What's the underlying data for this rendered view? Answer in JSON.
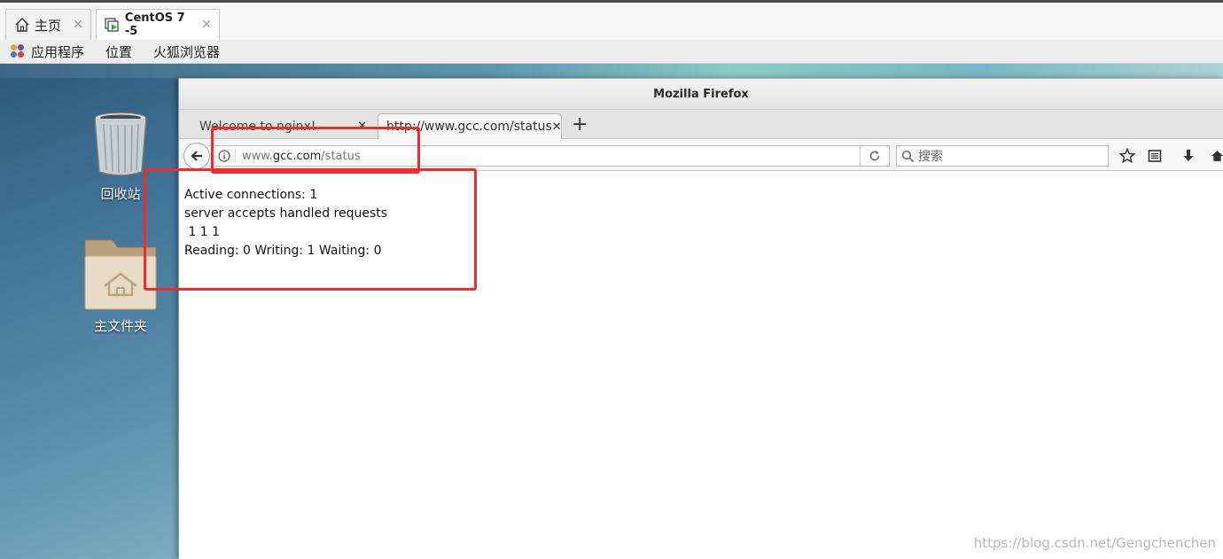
{
  "vmware_tabs": [
    {
      "label": "主页",
      "icon": "home-icon"
    },
    {
      "label": "CentOS 7 -5",
      "icon": "vm-play-icon"
    }
  ],
  "gnome_bar": {
    "applications": "应用程序",
    "places": "位置",
    "browser": "火狐浏览器"
  },
  "desktop": {
    "trash_label": "回收站",
    "home_label": "主文件夹"
  },
  "firefox": {
    "title": "Mozilla Firefox",
    "tabs": [
      {
        "label": "Welcome to nginx!"
      },
      {
        "label": "http://www.gcc.com/status"
      }
    ],
    "url_prefix": "www.",
    "url_domain": "gcc.com",
    "url_path": "/status",
    "search_placeholder": "搜索"
  },
  "page_content": {
    "line1": "Active connections: 1",
    "line2": "server accepts handled requests",
    "line3": " 1 1 1",
    "line4": "Reading: 0 Writing: 1 Waiting: 0"
  },
  "watermark": "https://blog.csdn.net/Gengchenchen",
  "colors": {
    "highlight": "#ef2b2b"
  }
}
